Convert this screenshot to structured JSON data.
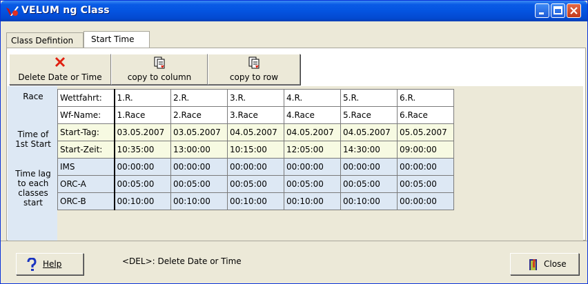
{
  "window": {
    "title": "VELUM ng Class"
  },
  "tabs": [
    {
      "label": "Class Defintion",
      "active": false
    },
    {
      "label": "Start Time",
      "active": true
    }
  ],
  "toolbar": {
    "delete_label": "Delete Date or Time",
    "copy_column_label": "copy to column",
    "copy_row_label": "copy to row"
  },
  "side": {
    "race": "Race",
    "time_of_start": "Time of 1st Start",
    "time_lag": "Time lag to each classes start"
  },
  "rows": {
    "wettfahrt": {
      "label": "Wettfahrt:",
      "values": [
        "1.R.",
        "2.R.",
        "3.R.",
        "4.R.",
        "5.R.",
        "6.R."
      ]
    },
    "wfname": {
      "label": "Wf-Name:",
      "values": [
        "1.Race",
        "2.Race",
        "3.Race",
        "4.Race",
        "5.Race",
        "6.Race"
      ]
    },
    "starttag": {
      "label": "Start-Tag:",
      "values": [
        "03.05.2007",
        "03.05.2007",
        "04.05.2007",
        "04.05.2007",
        "04.05.2007",
        "05.05.2007"
      ]
    },
    "startzeit": {
      "label": "Start-Zeit:",
      "values": [
        "10:35:00",
        "13:00:00",
        "10:15:00",
        "12:05:00",
        "14:30:00",
        "09:00:00"
      ]
    },
    "ims": {
      "label": "IMS",
      "values": [
        "00:00:00",
        "00:00:00",
        "00:00:00",
        "00:00:00",
        "00:00:00",
        "00:00:00"
      ]
    },
    "orca": {
      "label": "ORC-A",
      "values": [
        "00:05:00",
        "00:05:00",
        "00:05:00",
        "00:05:00",
        "00:05:00",
        "00:05:00"
      ]
    },
    "orcb": {
      "label": "ORC-B",
      "values": [
        "00:10:00",
        "00:10:00",
        "00:10:00",
        "00:10:00",
        "00:10:00",
        "00:00:00"
      ]
    }
  },
  "footer": {
    "help_label": "Help",
    "hint": "<DEL>: Delete Date or Time",
    "close_label": "Close"
  },
  "colors": {
    "titlebar": "#0454e0",
    "row_yellow": "#f7fae2",
    "row_blue": "#dde8f4",
    "delete_icon": "#e02010"
  }
}
